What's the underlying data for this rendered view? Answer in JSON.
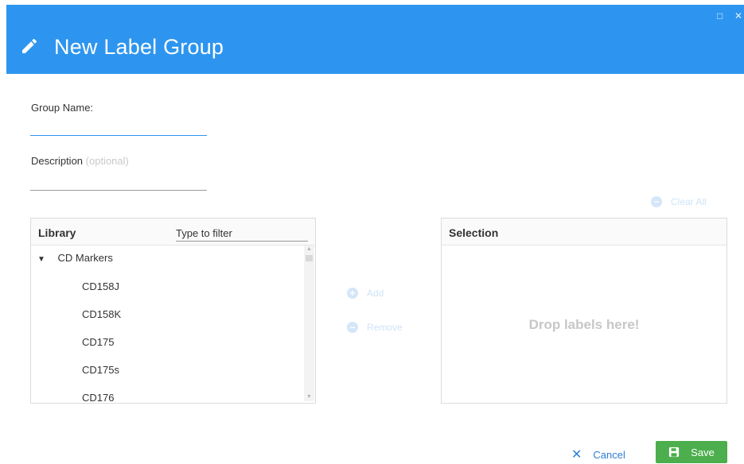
{
  "window": {
    "title": "New Label Group",
    "maximize_glyph": "□",
    "close_glyph": "✕",
    "accent_color": "#2d95ef"
  },
  "form": {
    "group_name_label": "Group Name:",
    "group_name_value": "",
    "description_label": "Description",
    "description_optional": "(optional)",
    "description_value": ""
  },
  "clear_all": {
    "label": "Clear All",
    "icon": "minus-circle-icon"
  },
  "library": {
    "title": "Library",
    "filter_placeholder": "Type to filter",
    "group": {
      "label": "CD Markers",
      "expanded": true,
      "icon": "chevron-down-icon"
    },
    "items": [
      "CD158J",
      "CD158K",
      "CD175",
      "CD175s",
      "CD176"
    ]
  },
  "actions": {
    "add_label": "Add",
    "add_icon": "plus-circle-icon",
    "remove_label": "Remove",
    "remove_icon": "minus-circle-icon"
  },
  "selection": {
    "title": "Selection",
    "drop_hint": "Drop labels here!"
  },
  "footer": {
    "cancel_label": "Cancel",
    "save_label": "Save",
    "save_color": "#4cae4c"
  }
}
